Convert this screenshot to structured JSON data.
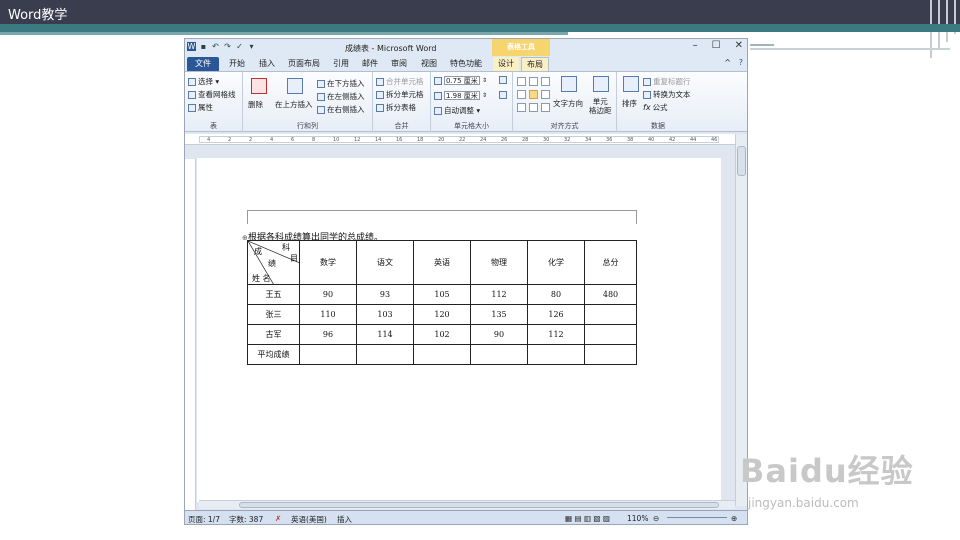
{
  "slide": {
    "title": "Word教学"
  },
  "word": {
    "doc_title": "成绩表 - Microsoft Word",
    "context_tab": "表格工具",
    "window_buttons": [
      "–",
      "☐",
      "✕"
    ],
    "tabs": [
      "文件",
      "开始",
      "插入",
      "页面布局",
      "引用",
      "邮件",
      "审阅",
      "视图",
      "特色功能",
      "设计",
      "布局"
    ],
    "ribbon": {
      "table": {
        "label": "表",
        "items": [
          "选择 ▾",
          "查看网格线",
          "属性"
        ]
      },
      "rows_cols": {
        "label": "行和列",
        "delete": "删除",
        "insert_above": "在上方插入",
        "insert_below": "在下方插入",
        "insert_left": "在左侧插入",
        "insert_right": "在右侧插入"
      },
      "merge": {
        "label": "合并",
        "items": [
          "合并单元格",
          "拆分单元格",
          "拆分表格"
        ]
      },
      "cell_size": {
        "label": "单元格大小",
        "height": "0.75 厘米",
        "width": "1.98 厘米",
        "autofit": "自动调整 ▾"
      },
      "alignment": {
        "label": "对齐方式",
        "text_direction": "文字方向",
        "cell_margins": "单元\n格边距"
      },
      "data": {
        "label": "数据",
        "sort": "排序",
        "repeat_header": "重复标题行",
        "convert": "转换为文本",
        "formula": "公式"
      }
    },
    "ruler_numbers": [
      "4",
      "2",
      "2",
      "4",
      "6",
      "8",
      "10",
      "12",
      "14",
      "16",
      "18",
      "20",
      "22",
      "24",
      "26",
      "28",
      "30",
      "32",
      "34",
      "36",
      "38",
      "40",
      "42",
      "44",
      "46"
    ],
    "document": {
      "intro": "根据各科成绩算出同学的总成绩。",
      "corner": {
        "subject_1": "科",
        "subject_2": "目",
        "score": "成",
        "score_2": "绩",
        "name": "姓 名"
      },
      "headers": [
        "数学",
        "语文",
        "英语",
        "物理",
        "化学",
        "总分"
      ],
      "rows": [
        {
          "name": "王五",
          "cells": [
            "90",
            "93",
            "105",
            "112",
            "80",
            "480"
          ]
        },
        {
          "name": "张三",
          "cells": [
            "110",
            "103",
            "120",
            "135",
            "126",
            ""
          ]
        },
        {
          "name": "古军",
          "cells": [
            "96",
            "114",
            "102",
            "90",
            "112",
            ""
          ]
        },
        {
          "name": "平均成绩",
          "cells": [
            "",
            "",
            "",
            "",
            "",
            ""
          ]
        }
      ]
    },
    "status": {
      "page": "页面: 1/7",
      "words": "字数: 387",
      "lang": "英语(美国)",
      "mode": "插入",
      "zoom": "110%"
    }
  },
  "watermark": {
    "main": "Baidu经验",
    "sub": "jingyan.baidu.com"
  }
}
